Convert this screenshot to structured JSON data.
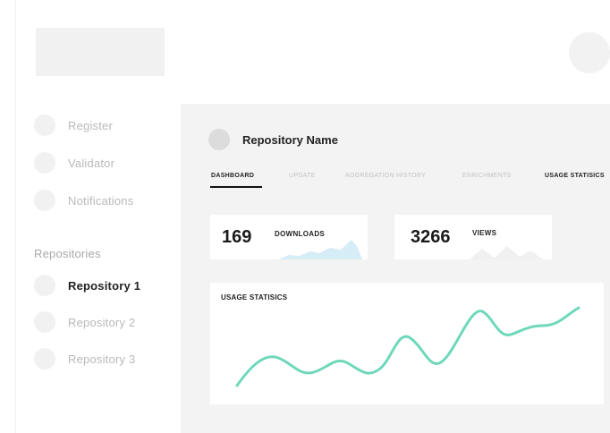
{
  "sidebar": {
    "items": [
      {
        "label": "Register"
      },
      {
        "label": "Validator"
      },
      {
        "label": "Notifications"
      }
    ],
    "section_heading": "Repositories",
    "repositories": [
      {
        "label": "Repository 1",
        "active": true
      },
      {
        "label": "Repository 2",
        "active": false
      },
      {
        "label": "Repository 3",
        "active": false
      }
    ]
  },
  "repository": {
    "name": "Repository Name"
  },
  "tabs": [
    {
      "label": "DASHBOARD",
      "active": true
    },
    {
      "label": "UPDATE"
    },
    {
      "label": "AGGREGATION HISTORY"
    },
    {
      "label": "ENRICHMENTS"
    },
    {
      "label": "USAGE STATISICS"
    }
  ],
  "stats": {
    "downloads": {
      "value": "169",
      "label": "DOWNLOADS"
    },
    "views": {
      "value": "3266",
      "label": "VIEWS"
    }
  },
  "chart": {
    "title": "USAGE STATISICS"
  },
  "colors": {
    "accent": "#6fd8bb",
    "sparkline": "#d6ecf7",
    "panel": "#f3f3f3"
  }
}
